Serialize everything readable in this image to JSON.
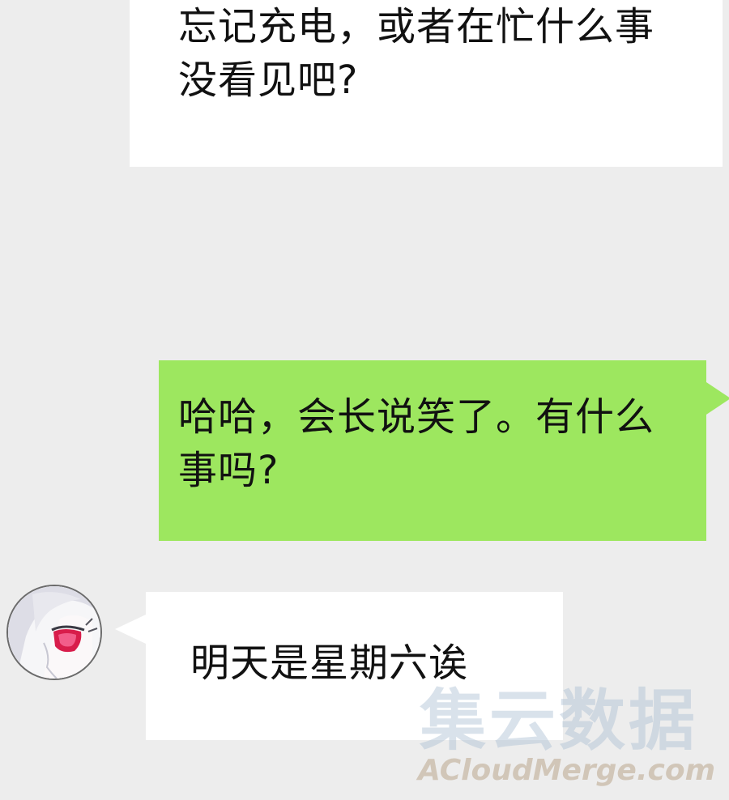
{
  "messages": [
    {
      "sender": "contact",
      "text": "忘记充电，或者在忙什么事没看见吧?"
    },
    {
      "sender": "self",
      "text": "哈哈，会长说笑了。有什么事吗?"
    },
    {
      "sender": "contact",
      "text": "明天是星期六诶"
    }
  ],
  "contact": {
    "avatar_icon": "white-haired-character-avatar-icon"
  },
  "watermark": {
    "title": "集云数据",
    "subtitle": "ACloudMerge.com"
  },
  "colors": {
    "background": "#ededed",
    "incoming_bubble": "#ffffff",
    "outgoing_bubble": "#9de75f",
    "text": "#111111"
  }
}
